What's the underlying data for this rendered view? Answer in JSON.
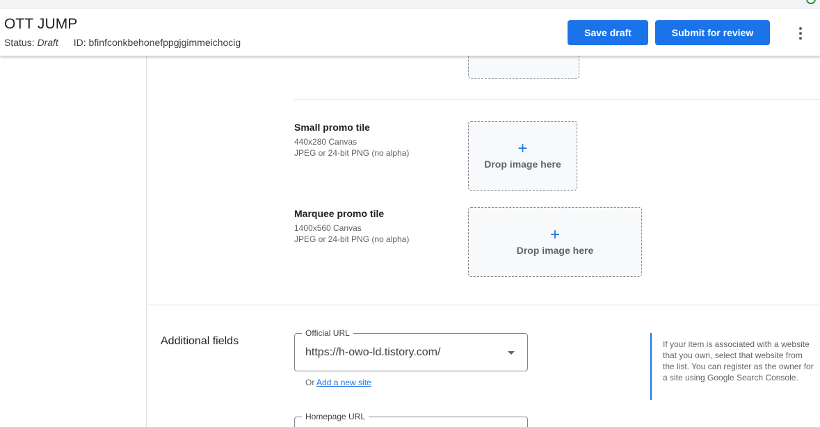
{
  "header": {
    "title": "OTT JUMP",
    "status_label": "Status:",
    "status_value": "Draft",
    "id_label": "ID:",
    "id_value": "bfinfconkbehonefppgjgimmeichocig",
    "save_label": "Save draft",
    "submit_label": "Submit for review",
    "more_icon": "more-vert-icon"
  },
  "tiles": {
    "small": {
      "title": "Small promo tile",
      "size": "440x280 Canvas",
      "format": "JPEG or 24-bit PNG (no alpha)",
      "drop_icon": "+",
      "drop_text": "Drop image here"
    },
    "marquee": {
      "title": "Marquee promo tile",
      "size": "1400x560 Canvas",
      "format": "JPEG or 24-bit PNG (no alpha)",
      "drop_icon": "+",
      "drop_text": "Drop image here"
    }
  },
  "additional": {
    "heading": "Additional fields",
    "official_url": {
      "label": "Official URL",
      "value": "https://h-owo-ld.tistory.com/"
    },
    "or_text": "Or",
    "add_site_link": "Add a new site",
    "help_text": "If your item is associated with a website that you own, select that website from the list. You can register as the owner for a site using Google Search Console.",
    "homepage_url": {
      "label": "Homepage URL"
    }
  },
  "colors": {
    "accent": "#1a73e8",
    "text": "#202124",
    "muted": "#5f6368"
  }
}
